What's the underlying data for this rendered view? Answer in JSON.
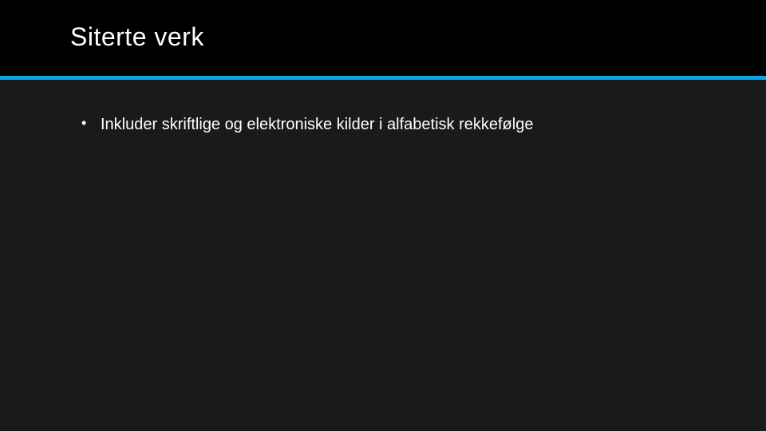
{
  "slide": {
    "title": "Siterte verk",
    "bullets": [
      "Inkluder skriftlige og elektroniske kilder i alfabetisk rekkefølge"
    ]
  },
  "colors": {
    "background": "#1a1a1a",
    "header": "#000000",
    "accent": "#05a6e1",
    "text": "#ffffff"
  }
}
